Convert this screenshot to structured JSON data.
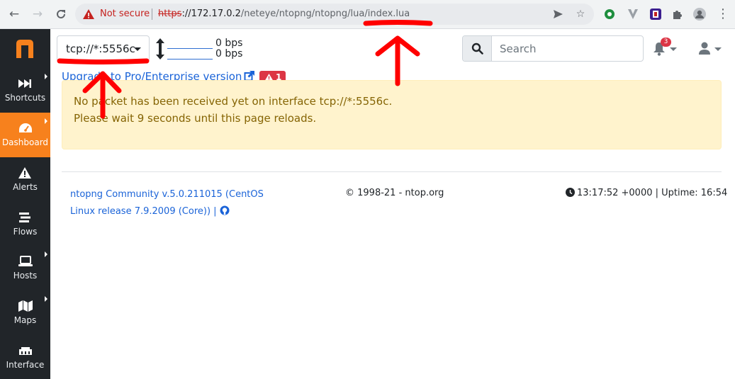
{
  "browser": {
    "security_label": "Not secure",
    "url_scheme": "https",
    "url_host": "://172.17.0.2",
    "url_path": "/neteye/ntopng/ntopng/lua/index.lua"
  },
  "sidebar": {
    "logo_text": "n",
    "items": [
      {
        "label": "Shortcuts",
        "icon": "fast-forward-icon",
        "has_submenu": true
      },
      {
        "label": "Dashboard",
        "icon": "gauge-icon",
        "has_submenu": true,
        "active": true
      },
      {
        "label": "Alerts",
        "icon": "warning-triangle-icon",
        "has_submenu": false
      },
      {
        "label": "Flows",
        "icon": "stream-icon",
        "has_submenu": false
      },
      {
        "label": "Hosts",
        "icon": "laptop-icon",
        "has_submenu": true
      },
      {
        "label": "Maps",
        "icon": "map-icon",
        "has_submenu": true
      },
      {
        "label": "Interface",
        "icon": "ethernet-icon",
        "has_submenu": false
      }
    ]
  },
  "topbar": {
    "interface_selected": "tcp://*:5556c",
    "upload_rate": "0 bps",
    "download_rate": "0 bps",
    "search_placeholder": "Search",
    "notification_count": "3"
  },
  "content": {
    "upgrade_link": "Upgrade to Pro/Enterprise version",
    "alert_count": "1",
    "warning_line1": "No packet has been received yet on interface tcp://*:5556c.",
    "warning_line2": "Please wait 9 seconds until this page reloads."
  },
  "footer": {
    "version_line1": "ntopng Community v.5.0.211015 (CentOS",
    "version_line2": "Linux release 7.9.2009 (Core)) |",
    "copyright": "© 1998-21 - ntop.org",
    "status": "13:17:52 +0000 | Uptime: 16:54"
  },
  "colors": {
    "brand_orange": "#f7811d",
    "sidebar_bg": "#212529",
    "link_blue": "#1a63d8",
    "danger_red": "#dc3545",
    "warning_bg": "#fff3cd",
    "annotation_red": "#ff0000"
  }
}
